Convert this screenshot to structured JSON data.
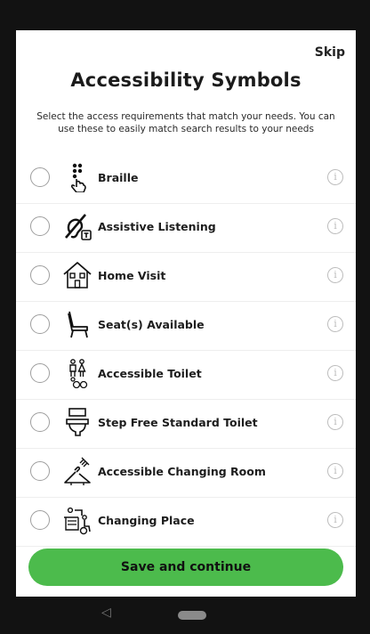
{
  "header": {
    "skip_label": "Skip",
    "title": "Accessibility Symbols",
    "subtitle": "Select the access requirements that match your needs. You can use these to easily match search results to your needs"
  },
  "options": [
    {
      "label": "Braille",
      "icon": "braille-icon",
      "selected": false
    },
    {
      "label": "Assistive Listening",
      "icon": "assistive-listening-icon",
      "selected": false
    },
    {
      "label": "Home Visit",
      "icon": "home-visit-icon",
      "selected": false
    },
    {
      "label": "Seat(s) Available",
      "icon": "seat-icon",
      "selected": false
    },
    {
      "label": "Accessible Toilet",
      "icon": "accessible-toilet-icon",
      "selected": false
    },
    {
      "label": "Step Free Standard Toilet",
      "icon": "step-free-toilet-icon",
      "selected": false
    },
    {
      "label": "Accessible Changing Room",
      "icon": "changing-room-icon",
      "selected": false
    },
    {
      "label": "Changing Place",
      "icon": "changing-place-icon",
      "selected": false
    }
  ],
  "info_glyph": "i",
  "footer": {
    "cta_label": "Save and continue",
    "back_glyph": "◁"
  },
  "colors": {
    "accent": "#4cbb4c",
    "radio_border": "#9e9e9e",
    "info": "#bdbdbd"
  }
}
